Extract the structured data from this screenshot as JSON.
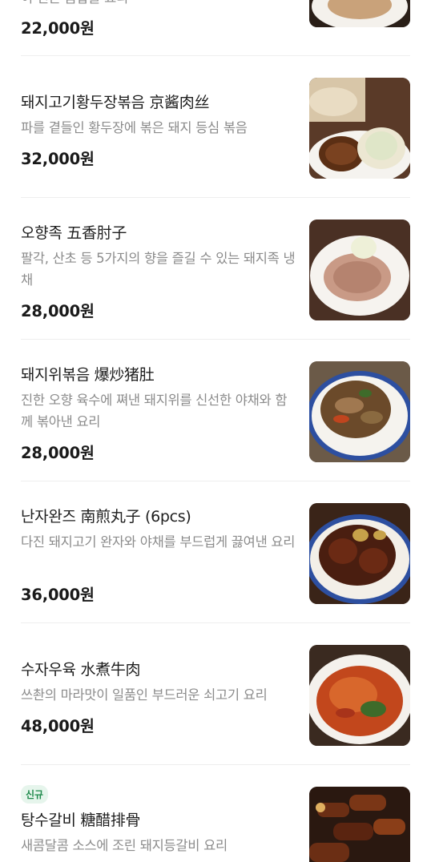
{
  "menu": {
    "items": [
      {
        "title": "",
        "description": "이 인는 음합을 요리",
        "price": "22,000원",
        "badge": ""
      },
      {
        "title": "돼지고기황두장볶음 京酱肉丝",
        "description": "파를 곁들인 황두장에 볶은 돼지 등심 볶음",
        "price": "32,000원",
        "badge": ""
      },
      {
        "title": "오향족 五香肘子",
        "description": "팔각, 산초 등 5가지의 향을 즐길 수 있는 돼지족 냉채",
        "price": "28,000원",
        "badge": ""
      },
      {
        "title": "돼지위볶음 爆炒猪肚",
        "description": "진한 오향 육수에 쪄낸 돼지위를 신선한 야채와 함께 볶아낸 요리",
        "price": "28,000원",
        "badge": ""
      },
      {
        "title": "난자완즈 南煎丸子 (6pcs)",
        "description": "다진 돼지고기 완자와 야채를 부드럽게 끓여낸 요리",
        "price": "36,000원",
        "badge": ""
      },
      {
        "title": "수자우육 水煮牛肉",
        "description": "쓰촨의 마라맛이 일품인 부드러운 쇠고기 요리",
        "price": "48,000원",
        "badge": ""
      },
      {
        "title": "탕수갈비 糖醋排骨",
        "description": "새콤달콤 소스에 조린 돼지등갈비 요리",
        "price": "",
        "badge": "신규"
      }
    ]
  }
}
